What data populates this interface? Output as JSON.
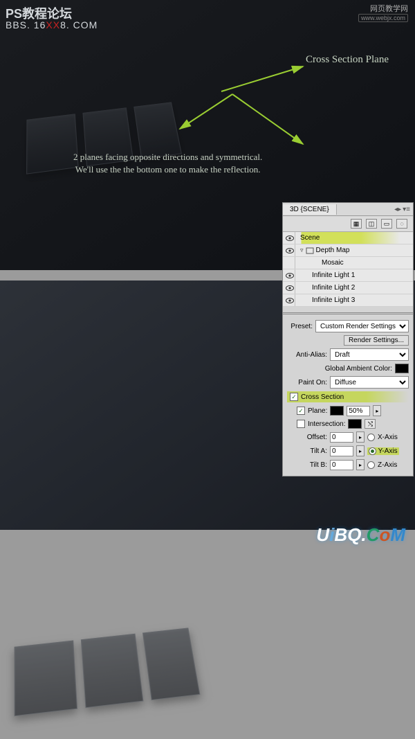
{
  "watermarks": {
    "forum_title": "PS教程论坛",
    "bbs_prefix": "BBS. 16",
    "bbs_red": "XX",
    "bbs_suffix": "8. COM",
    "top_right_main": "网页教学网",
    "top_right_sub": "www.webjx.com",
    "uibq_u": "U",
    "uibq_i": "i",
    "uibq_b": "B",
    "uibq_q": "Q.",
    "uibq_c": "C",
    "uibq_o": "o",
    "uibq_m": "M"
  },
  "annotations": {
    "cross_section": "Cross Section Plane",
    "caption_line1": "2 planes facing opposite directions and symmetrical.",
    "caption_line2": "We'll use the the bottom one to make the reflection."
  },
  "panel": {
    "tab_label": "3D {SCENE}",
    "tree": {
      "root": "Scene",
      "depth_map": "Depth Map",
      "mosaic": "Mosaic",
      "light1": "Infinite Light 1",
      "light2": "Infinite Light 2",
      "light3": "Infinite Light 3"
    },
    "preset_label": "Preset:",
    "preset_value": "Custom Render Settings",
    "render_settings_btn": "Render Settings...",
    "anti_alias_label": "Anti-Alias:",
    "anti_alias_value": "Draft",
    "global_color_label": "Global Ambient Color:",
    "paint_on_label": "Paint On:",
    "paint_on_value": "Diffuse",
    "cross_section_hdr": "Cross Section",
    "plane_label": "Plane:",
    "plane_opacity": "50%",
    "intersection_label": "Intersection:",
    "offset_label": "Offset:",
    "offset_value": "0",
    "tilt_a_label": "Tilt A:",
    "tilt_a_value": "0",
    "tilt_b_label": "Tilt B:",
    "tilt_b_value": "0",
    "x_axis": "X-Axis",
    "y_axis": "Y-Axis",
    "z_axis": "Z-Axis",
    "cross_section_checked": true,
    "plane_checked": true,
    "intersection_checked": false,
    "axis_selected": "y"
  }
}
